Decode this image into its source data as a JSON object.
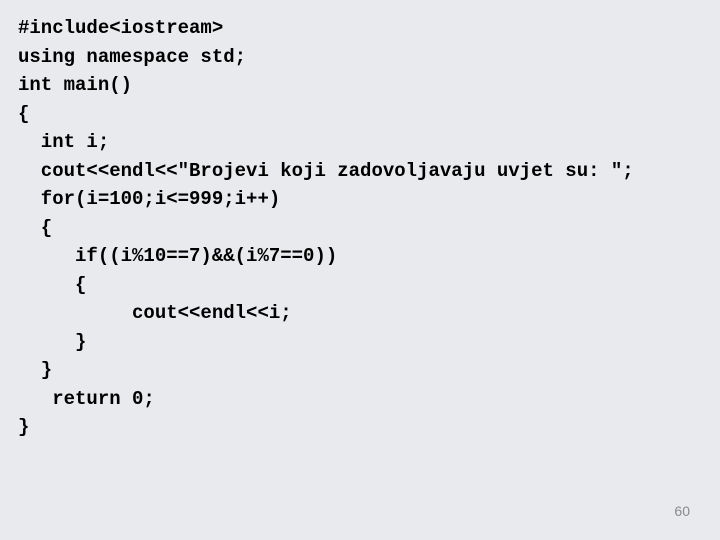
{
  "code": {
    "lines": [
      "#include<iostream>",
      "using namespace std;",
      "int main()",
      "{",
      "  int i;",
      "  cout<<endl<<\"Brojevi koji zadovoljavaju uvjet su: \";",
      "  for(i=100;i<=999;i++)",
      "  {",
      "     if((i%10==7)&&(i%7==0))",
      "     {",
      "          cout<<endl<<i;",
      "     }",
      "  }",
      "   return 0;",
      "}"
    ]
  },
  "page_number": "60"
}
